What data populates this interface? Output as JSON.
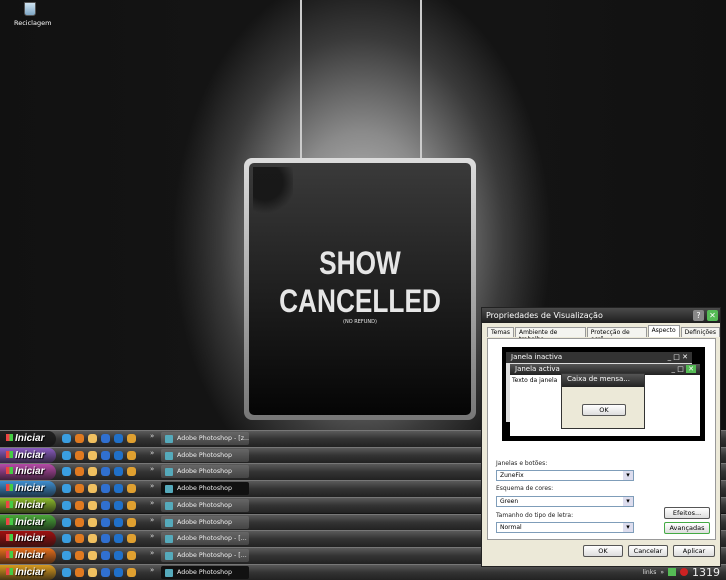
{
  "desktop": {
    "recycle_bin_label": "Reciclagem"
  },
  "sign": {
    "line1": "SHOW",
    "line2": "CANCELLED",
    "line3": "(NO REFUND)"
  },
  "taskbars": [
    {
      "start": "Iniciar",
      "color": "#222222",
      "task": "Adobe Photoshop - [z...",
      "active": false
    },
    {
      "start": "Iniciar",
      "color": "#8a5cc0",
      "task": "Adobe Photoshop",
      "active": false
    },
    {
      "start": "Iniciar",
      "color": "#b64aa8",
      "task": "Adobe Photoshop",
      "active": false
    },
    {
      "start": "Iniciar",
      "color": "#3f8fd0",
      "task": "Adobe Photoshop",
      "active": true
    },
    {
      "start": "Iniciar",
      "color": "#8dbb2c",
      "task": "Adobe Photoshop",
      "active": false
    },
    {
      "start": "Iniciar",
      "color": "#4aa83a",
      "task": "Adobe Photoshop",
      "active": false
    },
    {
      "start": "Iniciar",
      "color": "#a01010",
      "task": "Adobe Photoshop - [...",
      "active": false
    },
    {
      "start": "Iniciar",
      "color": "#e8701c",
      "task": "Adobe Photoshop - [...",
      "active": false
    },
    {
      "start": "Iniciar",
      "color": "#d89a20",
      "task": "Adobe Photoshop",
      "active": true
    }
  ],
  "quick_launch_icons": [
    "internet-explorer-icon",
    "firefox-icon",
    "messenger-icon",
    "winamp-icon",
    "media-icon",
    "flash-icon"
  ],
  "tray": {
    "links": "links",
    "more": "»",
    "clock": "1319"
  },
  "dialog": {
    "title": "Propriedades de Visualização",
    "tabs": [
      "Temas",
      "Ambiente de trabalho",
      "Protecção de ecrã",
      "Aspecto",
      "Definições"
    ],
    "active_tab": "Aspecto",
    "preview": {
      "inactive": "Janela inactiva",
      "active": "Janela activa",
      "text": "Texto da janela",
      "msgbox": "Caixa de mensa...",
      "ok": "OK"
    },
    "windows_label": "Janelas e botões:",
    "windows_value": "ZuneFix",
    "scheme_label": "Esquema de cores:",
    "scheme_value": "Green",
    "font_label": "Tamanho do tipo de letra:",
    "font_value": "Normal",
    "effects": "Efeitos...",
    "advanced": "Avançadas",
    "ok": "OK",
    "cancel": "Cancelar",
    "apply": "Aplicar"
  }
}
